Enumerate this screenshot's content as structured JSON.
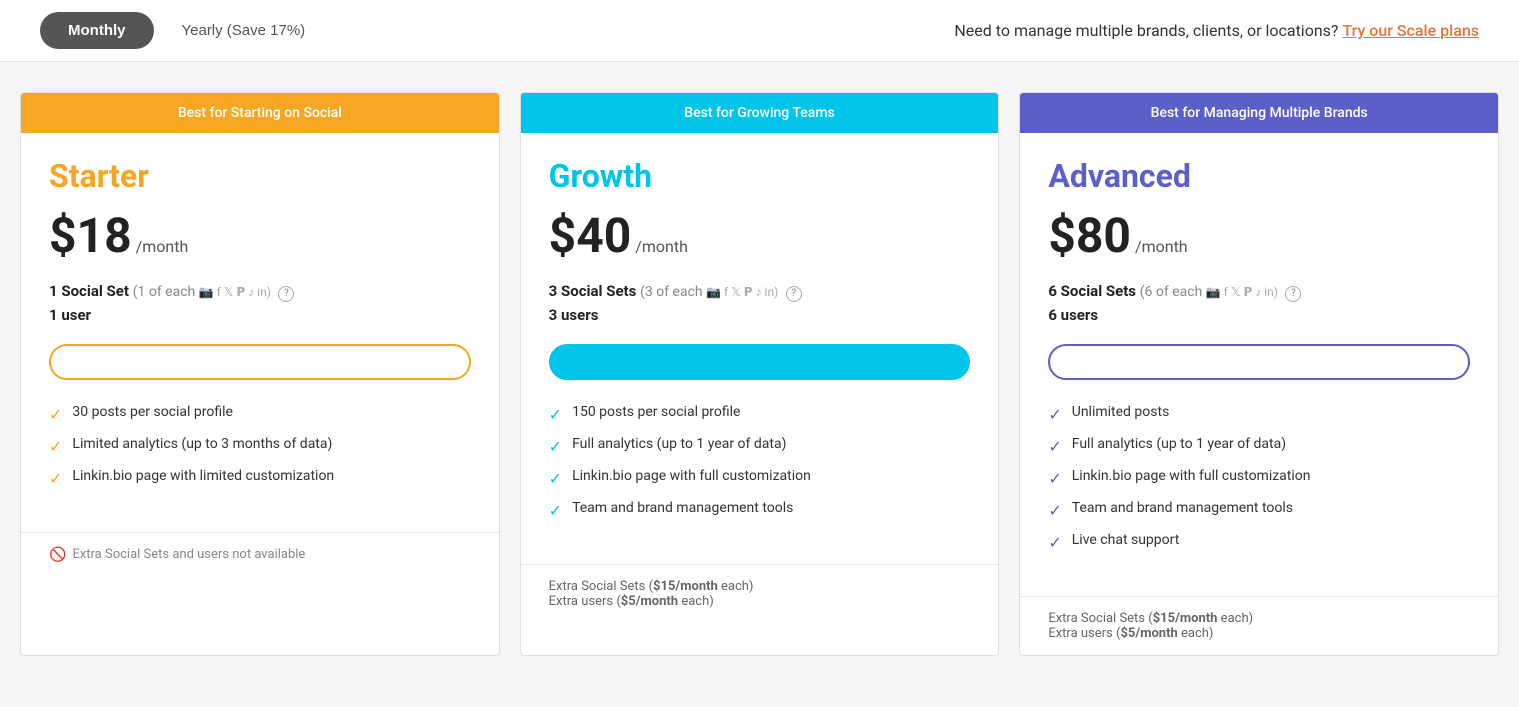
{
  "header": {
    "toggle_monthly": "Monthly",
    "toggle_yearly": "Yearly (Save 17%)",
    "cta_text": "Need to manage multiple brands, clients, or locations?",
    "cta_link": "Try our Scale plans"
  },
  "plans": [
    {
      "id": "starter",
      "banner": "Best for Starting on Social",
      "banner_class": "banner-starter",
      "name": "Starter",
      "name_class": "name-starter",
      "price": "$18",
      "period": "/month",
      "sets_label": "1 Social Set",
      "sets_detail": "(1 of each",
      "users": "1 user",
      "button_label": "",
      "button_class": "btn-starter",
      "features": [
        "30 posts per social profile",
        "Limited analytics (up to 3 months of data)",
        "Linkin.bio page with limited customization"
      ],
      "check_class": "check-icon",
      "footer_no_extra": true,
      "footer_no_extra_text": "Extra Social Sets and users not available",
      "footer_lines": []
    },
    {
      "id": "growth",
      "banner": "Best for Growing Teams",
      "banner_class": "banner-growth",
      "name": "Growth",
      "name_class": "name-growth",
      "price": "$40",
      "period": "/month",
      "sets_label": "3 Social Sets",
      "sets_detail": "(3 of each",
      "users": "3 users",
      "button_label": "",
      "button_class": "btn-growth",
      "features": [
        "150 posts per social profile",
        "Full analytics (up to 1 year of data)",
        "Linkin.bio page with full customization",
        "Team and brand management tools"
      ],
      "check_class": "check-icon check-icon-blue",
      "footer_no_extra": false,
      "footer_lines": [
        "Extra Social Sets ($15/month each)",
        "Extra users ($5/month each)"
      ]
    },
    {
      "id": "advanced",
      "banner": "Best for Managing Multiple Brands",
      "banner_class": "banner-advanced",
      "name": "Advanced",
      "name_class": "name-advanced",
      "price": "$80",
      "period": "/month",
      "sets_label": "6 Social Sets",
      "sets_detail": "(6 of each",
      "users": "6 users",
      "button_label": "",
      "button_class": "btn-advanced",
      "features": [
        "Unlimited posts",
        "Full analytics (up to 1 year of data)",
        "Linkin.bio page with full customization",
        "Team and brand management tools",
        "Live chat support"
      ],
      "check_class": "check-icon check-icon-purple",
      "footer_no_extra": false,
      "footer_lines": [
        "Extra Social Sets ($15/month each)",
        "Extra users ($5/month each)"
      ]
    }
  ]
}
